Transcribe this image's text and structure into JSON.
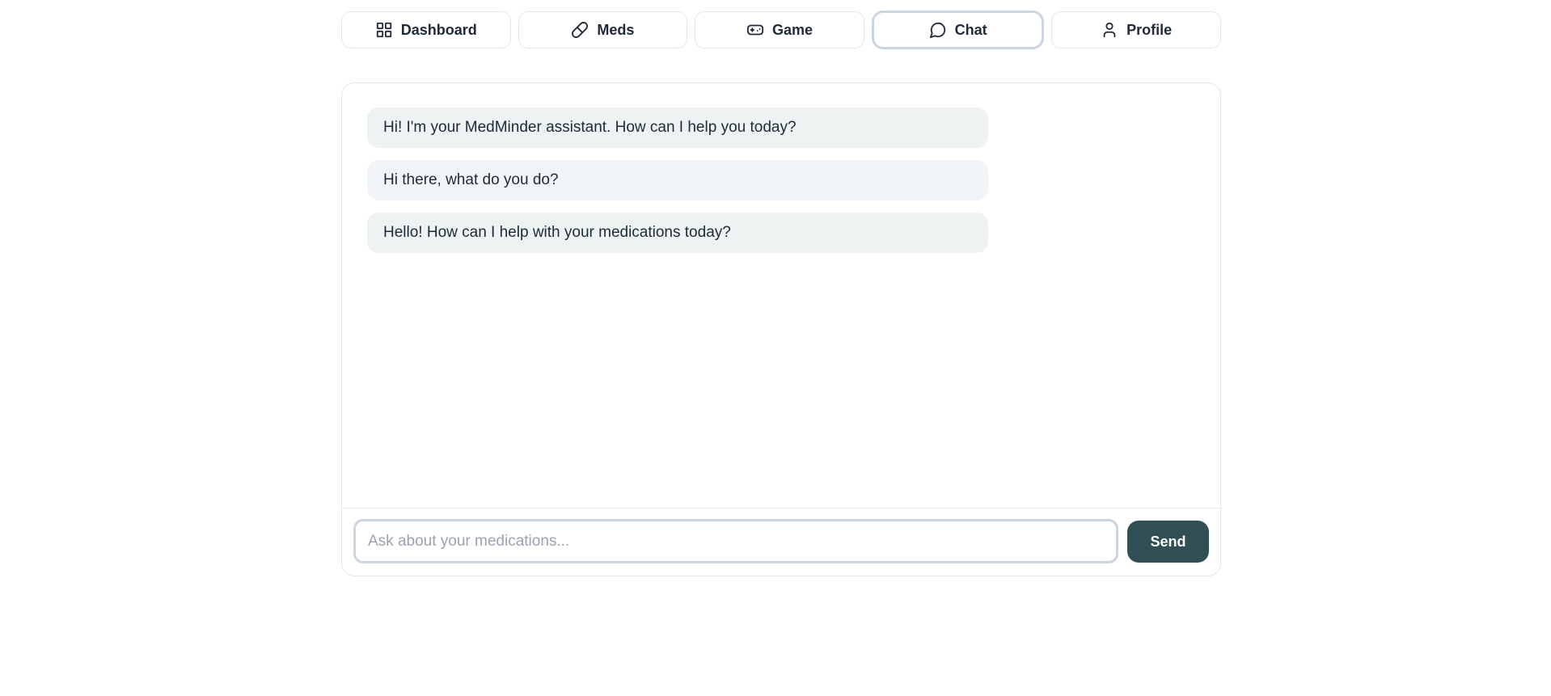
{
  "nav": {
    "tabs": [
      {
        "label": "Dashboard",
        "icon": "grid-icon"
      },
      {
        "label": "Meds",
        "icon": "pill-icon"
      },
      {
        "label": "Game",
        "icon": "gamepad-icon"
      },
      {
        "label": "Chat",
        "icon": "chat-bubble-icon",
        "active": true
      },
      {
        "label": "Profile",
        "icon": "user-icon"
      }
    ]
  },
  "chat": {
    "messages": [
      {
        "role": "assistant",
        "text": "Hi! I'm your MedMinder assistant. How can I help you today?"
      },
      {
        "role": "user",
        "text": "Hi there, what do you do?"
      },
      {
        "role": "assistant",
        "text": "Hello! How can I help with your medications today?"
      }
    ],
    "input_placeholder": "Ask about your medications...",
    "input_value": "",
    "send_label": "Send"
  },
  "colors": {
    "accent": "#2f4f54",
    "assistant_bubble": "#edf3f3",
    "user_bubble": "#f1f5f9",
    "border": "#e5e7eb"
  }
}
